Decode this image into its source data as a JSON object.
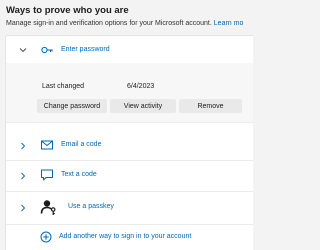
{
  "header": {
    "title": "Ways to prove who you are",
    "subtitle": "Manage sign-in and verification options for your Microsoft account.",
    "learn_more": "Learn mo"
  },
  "methods": [
    {
      "label": "Enter password",
      "icon": "key-icon",
      "expanded": true
    },
    {
      "label": "Email a code",
      "icon": "mail-icon",
      "expanded": false
    },
    {
      "label": "Text a code",
      "icon": "chat-icon",
      "expanded": false
    },
    {
      "label": "Use a passkey",
      "icon": "passkey-icon",
      "expanded": false
    }
  ],
  "password": {
    "last_changed_label": "Last changed",
    "last_changed_date": "6/4/2023",
    "change_button": "Change password",
    "view_button": "View activity",
    "remove_button": "Remove"
  },
  "add": {
    "label": "Add another way to sign in to your account",
    "icon": "plus-circle-icon"
  },
  "colors": {
    "accent": "#0067b8",
    "background": "#f3f3f3",
    "panel": "#ffffff",
    "button": "#e9e9e9"
  }
}
